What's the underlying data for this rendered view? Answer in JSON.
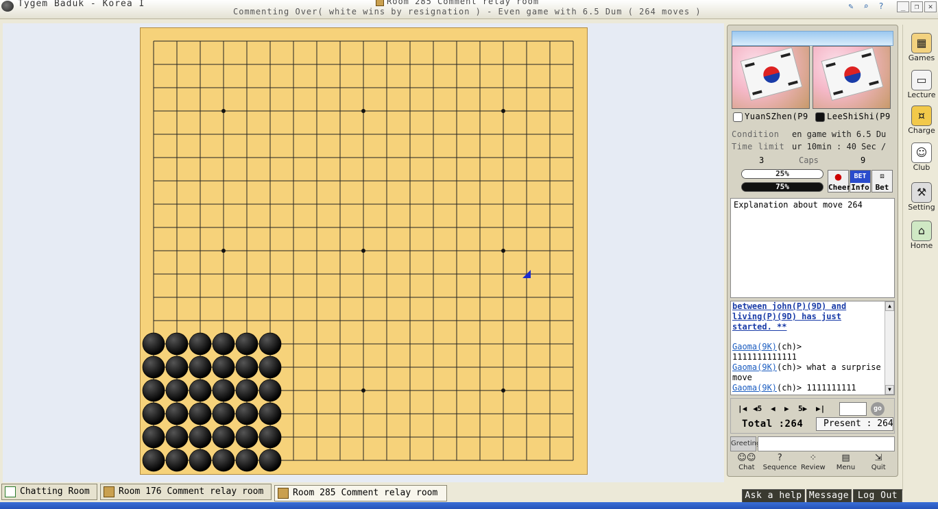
{
  "window": {
    "app_title": "Tygem Baduk - Korea I",
    "room_title": "Room 285 Comment relay room",
    "subtitle": "Commenting Over( white wins by resignation ) - Even game with 6.5 Dum  ( 264 moves )"
  },
  "board": {
    "size": 19,
    "black": [
      "A1",
      "A2",
      "A3",
      "A4",
      "A5",
      "A6",
      "B1",
      "B2",
      "B3",
      "B4",
      "B5",
      "B6",
      "C1",
      "C2",
      "C3",
      "C4",
      "C5",
      "C6",
      "D1",
      "D2",
      "D3",
      "D4",
      "D5",
      "D6",
      "E1",
      "E2",
      "E3",
      "E4",
      "E5",
      "E6",
      "F1",
      "F2",
      "F3",
      "F4",
      "F5",
      "F6"
    ],
    "white": [],
    "last_move": "R9"
  },
  "players": {
    "white_name": "YuanSZhen(P9",
    "black_name": "LeeShiShi(P9",
    "condition_label": "Condition",
    "condition_value": "en game with 6.5 Du",
    "time_label": "Time limit",
    "time_value": "ur 10min : 40 Sec /",
    "caps_label": "Caps",
    "white_caps": "3",
    "black_caps": "9",
    "white_pct": "25%",
    "black_pct": "75%",
    "white_pct_value": 25,
    "black_pct_value": 75
  },
  "side_buttons": {
    "cheer": "Cheer",
    "info": "Info",
    "bet": "Bet",
    "bet_badge": "BET"
  },
  "explanation": "Explanation about move 264",
  "chat": {
    "notice": "between john(P)(9D) and living(P)(9D) has just started. **",
    "lines": [
      {
        "nick": "Gaoma(9K)",
        "suffix": "(ch)>",
        "text": "1111111111111"
      },
      {
        "nick": "Gaoma(9K)",
        "suffix": "(ch)>",
        "text": "what a surprise move"
      },
      {
        "nick": "Gaoma(9K)",
        "suffix": "(ch)>",
        "text": "1111111111"
      }
    ]
  },
  "navigation": {
    "first": "|◀",
    "back5": "◀5",
    "back": "◀",
    "forward": "▶",
    "forward5": "5▶",
    "last": "▶|",
    "go": "go",
    "total_label": "Total :264",
    "present_label": "Present : 264"
  },
  "greeting_label": "Greeting",
  "tools": [
    "Chat",
    "Sequence",
    "Review",
    "Menu",
    "Quit"
  ],
  "sidebar": [
    "Games",
    "Lecture",
    "Charge",
    "Club",
    "Setting",
    "Home"
  ],
  "tabs": [
    "Chatting Room",
    "Room 176 Comment relay room",
    "Room 285 Comment relay room"
  ],
  "bottom_buttons": [
    "Ask a help",
    "Message",
    "Log Out"
  ]
}
